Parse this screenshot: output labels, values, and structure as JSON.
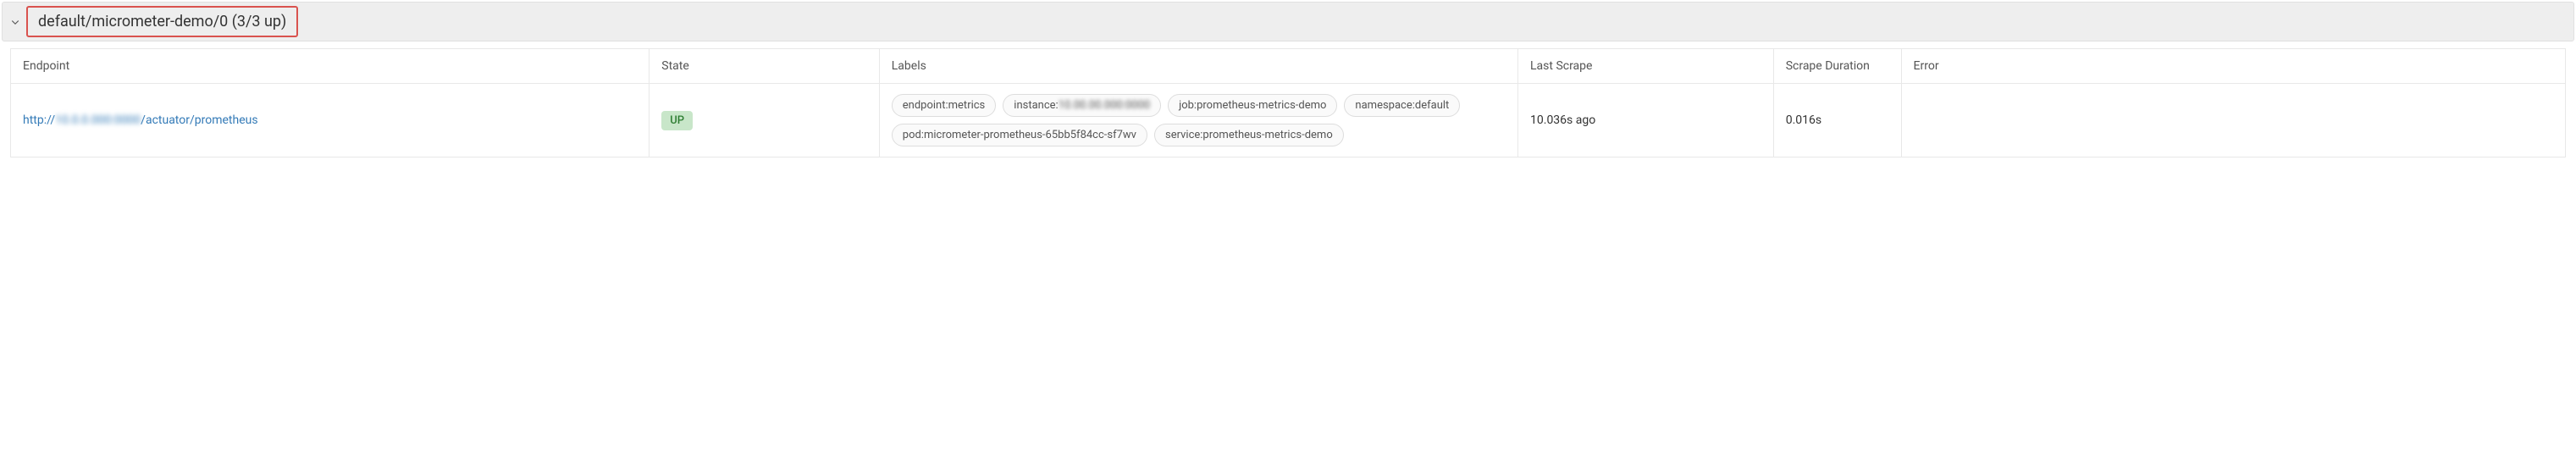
{
  "target": {
    "title": "default/micrometer-demo/0 (3/3 up)"
  },
  "columns": {
    "endpoint": "Endpoint",
    "state": "State",
    "labels": "Labels",
    "last_scrape": "Last Scrape",
    "scrape_duration": "Scrape Duration",
    "error": "Error"
  },
  "row": {
    "endpoint_prefix": "http://",
    "endpoint_host_redacted": "10.0.0.000:0000",
    "endpoint_suffix": "/actuator/prometheus",
    "state": "UP",
    "labels": [
      {
        "key": "endpoint",
        "value": "metrics",
        "redacted": false
      },
      {
        "key": "instance",
        "value": "10.00.00.000:0000",
        "redacted": true
      },
      {
        "key": "job",
        "value": "prometheus-metrics-demo",
        "redacted": false
      },
      {
        "key": "namespace",
        "value": "default",
        "redacted": false
      },
      {
        "key": "pod",
        "value": "micrometer-prometheus-65bb5f84cc-sf7wv",
        "redacted": false
      },
      {
        "key": "service",
        "value": "prometheus-metrics-demo",
        "redacted": false
      }
    ],
    "last_scrape": "10.036s ago",
    "scrape_duration": "0.016s",
    "error": ""
  }
}
